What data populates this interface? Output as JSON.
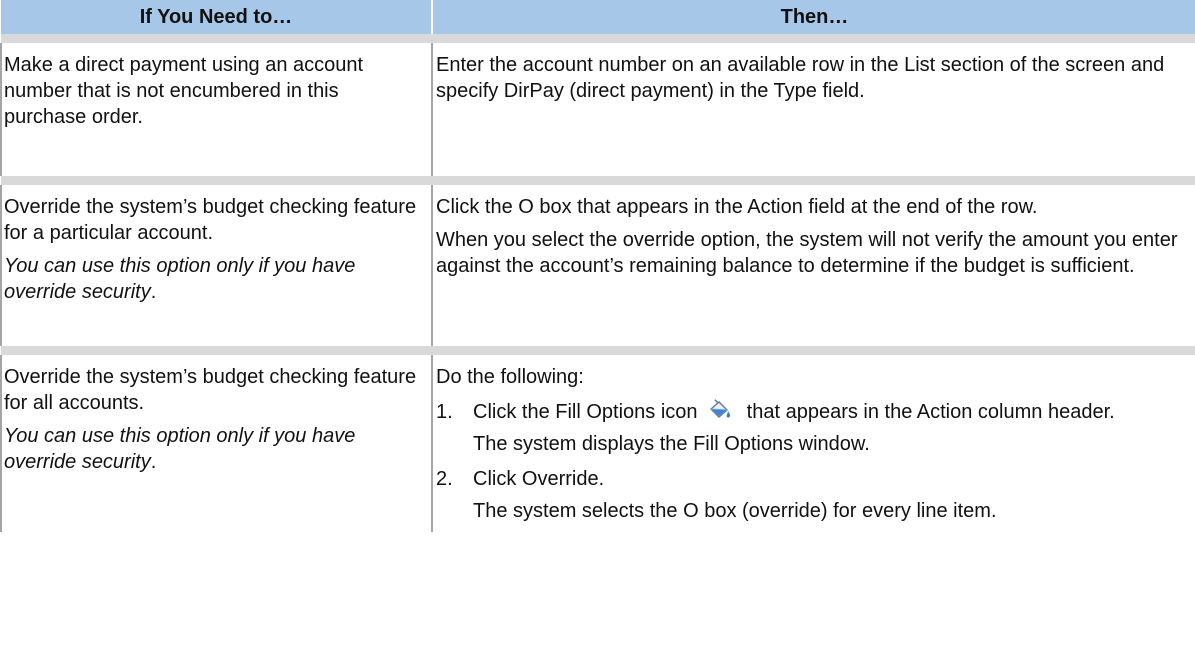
{
  "table": {
    "headers": [
      "If You Need to…",
      "Then…"
    ],
    "rows": [
      {
        "need": [
          "Make a direct payment using an account number that is not encumbered in this purchase order."
        ],
        "then": [
          "Enter the account number on an available row in the List section of the screen and specify DirPay (direct payment) in the Type field."
        ]
      },
      {
        "need": [
          "Override the system’s budget checking feature for a particular account."
        ],
        "need_note": "You can use this option only if you have override security",
        "need_note_end": ".",
        "then": [
          "Click the O box that appears in the Action field at the end of the row.",
          "When you select the override option, the system will not verify the amount you enter against the account’s remaining balance to determine if the budget is sufficient."
        ]
      },
      {
        "need": [
          "Override the system’s budget checking feature for all accounts."
        ],
        "need_note": "You can use this option only if you have override security",
        "need_note_end": ".",
        "then_intro": "Do the following:",
        "steps": [
          {
            "num": "1.",
            "text_before_icon": "Click the Fill Options icon",
            "icon": "fill-options-icon",
            "text_after_icon": "that appears in the Action column header.",
            "result": "The system displays the Fill Options window."
          },
          {
            "num": "2.",
            "text": "Click Override.",
            "result": "The system selects the O box (override) for every line item."
          }
        ]
      }
    ]
  }
}
